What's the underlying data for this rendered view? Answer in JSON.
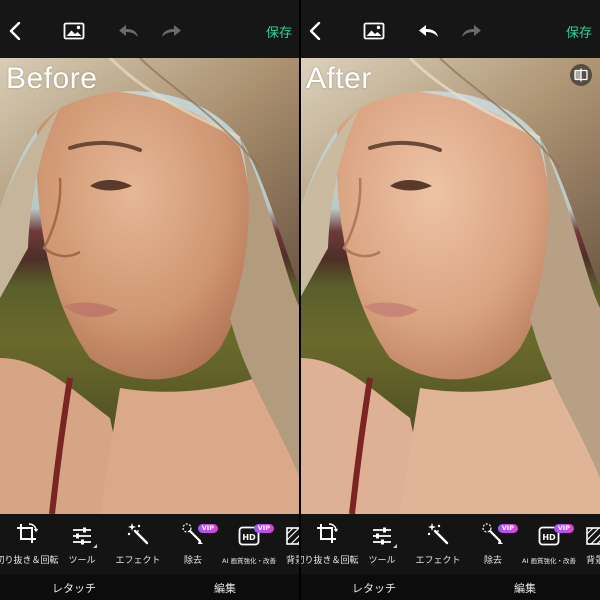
{
  "panels": [
    {
      "id": "before",
      "label": "Before",
      "save_label": "保存",
      "undo_active": false,
      "show_compare": false
    },
    {
      "id": "after",
      "label": "After",
      "save_label": "保存",
      "undo_active": true,
      "show_compare": true
    }
  ],
  "toolbar": {
    "items": [
      {
        "icon": "crop-rotate-icon",
        "label": "切り抜き＆回転"
      },
      {
        "icon": "sliders-icon",
        "label": "ツール"
      },
      {
        "icon": "magic-wand-icon",
        "label": "エフェクト"
      },
      {
        "icon": "eraser-brush-icon",
        "label": "除去",
        "badge": "VIP"
      },
      {
        "icon": "hd-icon",
        "label": "AI 画質強化・改善",
        "badge": "VIP"
      },
      {
        "icon": "background-icon",
        "label": "背景"
      }
    ]
  },
  "tabs": [
    {
      "label": "レタッチ"
    },
    {
      "label": "編集"
    }
  ],
  "colors": {
    "accent": "#28d6a0",
    "vip_gradient_start": "#9a5cff",
    "vip_gradient_end": "#e23fd1",
    "background": "#121212"
  }
}
